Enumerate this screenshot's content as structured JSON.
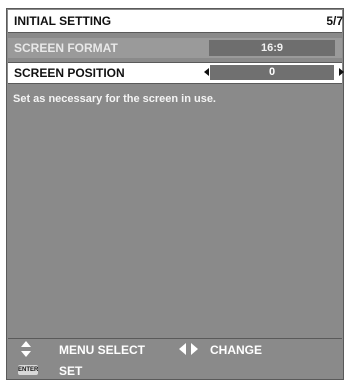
{
  "header": {
    "title": "INITIAL SETTING",
    "page": "5/7"
  },
  "menu": {
    "items": [
      {
        "label": "SCREEN FORMAT",
        "value": "16:9",
        "state": "disabled"
      },
      {
        "label": "SCREEN POSITION",
        "value": "0",
        "state": "selected"
      }
    ]
  },
  "description": "Set as necessary for the screen in use.",
  "footer": {
    "menu_select": "MENU SELECT",
    "change": "CHANGE",
    "set": "SET",
    "enter_key": "ENTER",
    "icons": [
      "up-down-arrow-icon",
      "left-right-arrow-icon",
      "enter-key-icon"
    ]
  },
  "colors": {
    "panel": "#8a8a8a",
    "selected_row": "#ffffff",
    "value_box": "#707070"
  }
}
